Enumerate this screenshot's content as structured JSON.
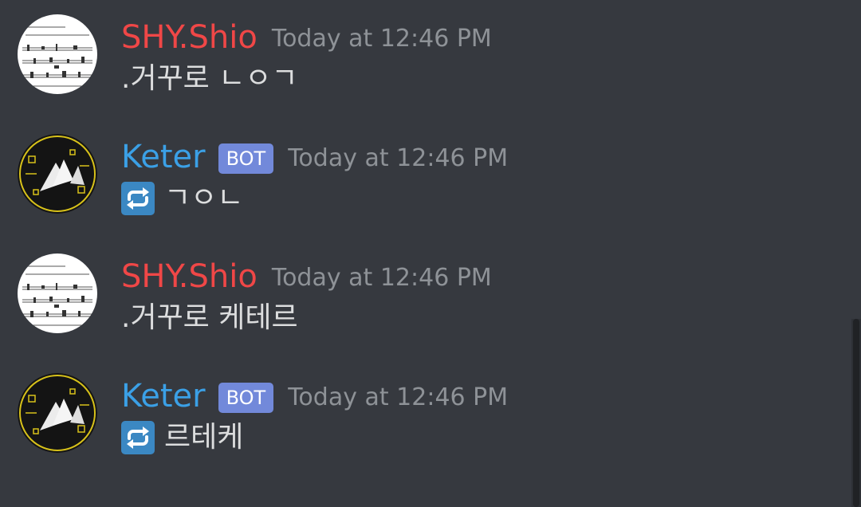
{
  "colors": {
    "background": "#36393f",
    "user_name_color": "#f04747",
    "bot_name_color": "#3ba0e6",
    "bot_tag_bg": "#7289da",
    "timestamp": "#8e9297",
    "message_text": "#dcddde",
    "repeat_emoji_bg": "#3b88c3"
  },
  "messages": [
    {
      "author": "SHY.Shio",
      "is_bot": false,
      "timestamp": "Today at 12:46 PM",
      "content": ".거꾸로 ㄴㅇㄱ",
      "avatar": "sheet-music-avatar"
    },
    {
      "author": "Keter",
      "is_bot": true,
      "bot_tag": "BOT",
      "timestamp": "Today at 12:46 PM",
      "content": "ㄱㅇㄴ",
      "emoji": "repeat-icon",
      "avatar": "keter-avatar"
    },
    {
      "author": "SHY.Shio",
      "is_bot": false,
      "timestamp": "Today at 12:46 PM",
      "content": ".거꾸로 케테르",
      "avatar": "sheet-music-avatar"
    },
    {
      "author": "Keter",
      "is_bot": true,
      "bot_tag": "BOT",
      "timestamp": "Today at 12:46 PM",
      "content": "르테케",
      "emoji": "repeat-icon",
      "avatar": "keter-avatar"
    }
  ]
}
